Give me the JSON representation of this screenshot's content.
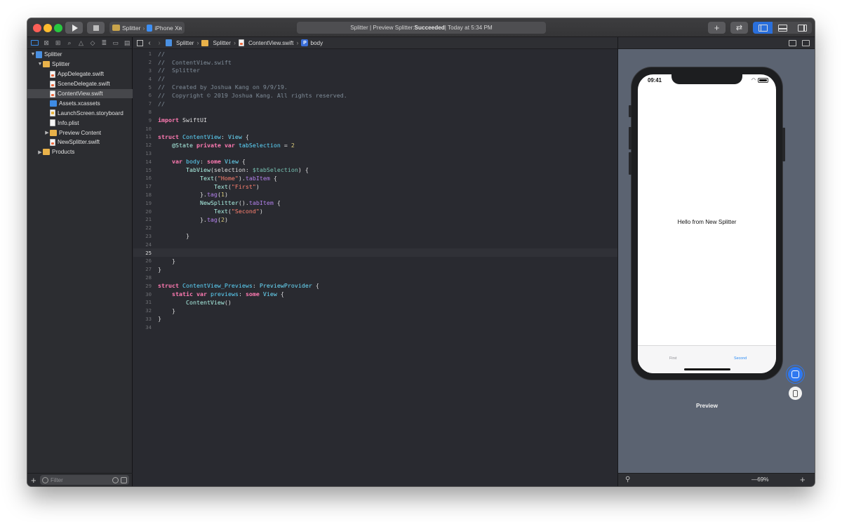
{
  "toolbar": {
    "scheme_name": "Splitter",
    "device_name": "iPhone Xʀ",
    "status_prefix": "Splitter | Preview Splitter: ",
    "status_result": "Succeeded",
    "status_suffix": " | Today at 5:34 PM",
    "add_label": "+",
    "swap_label": "⇄"
  },
  "navigator": {
    "items": [
      {
        "label": "Splitter",
        "icon": "project-icon",
        "level": 0,
        "disclosure": "open"
      },
      {
        "label": "Splitter",
        "icon": "folder-icon",
        "level": 1,
        "disclosure": "open"
      },
      {
        "label": "AppDelegate.swift",
        "icon": "swift-file-icon",
        "level": 2,
        "disclosure": ""
      },
      {
        "label": "SceneDelegate.swift",
        "icon": "swift-file-icon",
        "level": 2,
        "disclosure": ""
      },
      {
        "label": "ContentView.swift",
        "icon": "swift-file-icon",
        "level": 2,
        "disclosure": "",
        "selected": true
      },
      {
        "label": "Assets.xcassets",
        "icon": "assets-icon",
        "level": 2,
        "disclosure": ""
      },
      {
        "label": "LaunchScreen.storyboard",
        "icon": "storyboard-icon",
        "level": 2,
        "disclosure": ""
      },
      {
        "label": "Info.plist",
        "icon": "plist-icon",
        "level": 2,
        "disclosure": ""
      },
      {
        "label": "Preview Content",
        "icon": "folder-icon",
        "level": 2,
        "disclosure": "closed"
      },
      {
        "label": "NewSplitter.swift",
        "icon": "swift-file-icon",
        "level": 2,
        "disclosure": ""
      },
      {
        "label": "Products",
        "icon": "folder-icon",
        "level": 1,
        "disclosure": "closed"
      }
    ],
    "filter_placeholder": "Filter",
    "add_label": "+"
  },
  "jumpbar": {
    "crumbs": [
      "Splitter",
      "Splitter",
      "ContentView.swift",
      "body"
    ],
    "symbol_badge": "P"
  },
  "editor": {
    "current_line": 25,
    "lines": [
      [
        [
          "comment",
          "//"
        ]
      ],
      [
        [
          "comment",
          "//  ContentView.swift"
        ]
      ],
      [
        [
          "comment",
          "//  Splitter"
        ]
      ],
      [
        [
          "comment",
          "//"
        ]
      ],
      [
        [
          "comment",
          "//  Created by Joshua Kang on 9/9/19."
        ]
      ],
      [
        [
          "comment",
          "//  Copyright © 2019 Joshua Kang. All rights reserved."
        ]
      ],
      [
        [
          "comment",
          "//"
        ]
      ],
      [],
      [
        [
          "keyword",
          "import"
        ],
        [
          "plain",
          " SwiftUI"
        ]
      ],
      [],
      [
        [
          "keyword",
          "struct"
        ],
        [
          "plain",
          " "
        ],
        [
          "decl",
          "ContentView"
        ],
        [
          "plain",
          ": "
        ],
        [
          "typeref",
          "View"
        ],
        [
          "plain",
          " {"
        ]
      ],
      [
        [
          "plain",
          "    "
        ],
        [
          "type",
          "@State"
        ],
        [
          "plain",
          " "
        ],
        [
          "keyword",
          "private"
        ],
        [
          "plain",
          " "
        ],
        [
          "keyword",
          "var"
        ],
        [
          "plain",
          " "
        ],
        [
          "decl",
          "tabSelection"
        ],
        [
          "plain",
          " = "
        ],
        [
          "number",
          "2"
        ]
      ],
      [],
      [
        [
          "plain",
          "    "
        ],
        [
          "keyword",
          "var"
        ],
        [
          "plain",
          " "
        ],
        [
          "decl",
          "body"
        ],
        [
          "plain",
          ": "
        ],
        [
          "keyword",
          "some"
        ],
        [
          "plain",
          " "
        ],
        [
          "typeref",
          "View"
        ],
        [
          "plain",
          " {"
        ]
      ],
      [
        [
          "plain",
          "        "
        ],
        [
          "type",
          "TabView"
        ],
        [
          "plain",
          "(selection: "
        ],
        [
          "var",
          "$tabSelection"
        ],
        [
          "plain",
          ") {"
        ]
      ],
      [
        [
          "plain",
          "            "
        ],
        [
          "type",
          "Text"
        ],
        [
          "plain",
          "("
        ],
        [
          "string",
          "\"Home\""
        ],
        [
          "plain",
          ")."
        ],
        [
          "call",
          "tabItem"
        ],
        [
          "plain",
          " {"
        ]
      ],
      [
        [
          "plain",
          "                "
        ],
        [
          "type",
          "Text"
        ],
        [
          "plain",
          "("
        ],
        [
          "string",
          "\"First\""
        ],
        [
          "plain",
          ")"
        ]
      ],
      [
        [
          "plain",
          "            }."
        ],
        [
          "call",
          "tag"
        ],
        [
          "plain",
          "("
        ],
        [
          "number",
          "1"
        ],
        [
          "plain",
          ")"
        ]
      ],
      [
        [
          "plain",
          "            "
        ],
        [
          "type",
          "NewSplitter"
        ],
        [
          "plain",
          "()."
        ],
        [
          "call",
          "tabItem"
        ],
        [
          "plain",
          " {"
        ]
      ],
      [
        [
          "plain",
          "                "
        ],
        [
          "type",
          "Text"
        ],
        [
          "plain",
          "("
        ],
        [
          "string",
          "\"Second\""
        ],
        [
          "plain",
          ")"
        ]
      ],
      [
        [
          "plain",
          "            }."
        ],
        [
          "call",
          "tag"
        ],
        [
          "plain",
          "("
        ],
        [
          "number",
          "2"
        ],
        [
          "plain",
          ")"
        ]
      ],
      [],
      [
        [
          "plain",
          "        }"
        ]
      ],
      [],
      [],
      [
        [
          "plain",
          "    }"
        ]
      ],
      [
        [
          "plain",
          "}"
        ]
      ],
      [],
      [
        [
          "keyword",
          "struct"
        ],
        [
          "plain",
          " "
        ],
        [
          "decl",
          "ContentView_Previews"
        ],
        [
          "plain",
          ": "
        ],
        [
          "typeref",
          "PreviewProvider"
        ],
        [
          "plain",
          " {"
        ]
      ],
      [
        [
          "plain",
          "    "
        ],
        [
          "keyword",
          "static"
        ],
        [
          "plain",
          " "
        ],
        [
          "keyword",
          "var"
        ],
        [
          "plain",
          " "
        ],
        [
          "decl",
          "previews"
        ],
        [
          "plain",
          ": "
        ],
        [
          "keyword",
          "some"
        ],
        [
          "plain",
          " "
        ],
        [
          "typeref",
          "View"
        ],
        [
          "plain",
          " {"
        ]
      ],
      [
        [
          "plain",
          "        "
        ],
        [
          "type",
          "ContentView"
        ],
        [
          "plain",
          "()"
        ]
      ],
      [
        [
          "plain",
          "    }"
        ]
      ],
      [
        [
          "plain",
          "}"
        ]
      ],
      []
    ]
  },
  "preview": {
    "status_time": "09:41",
    "hello_text": "Hello from New Splitter",
    "tabs": [
      "First",
      "Second"
    ],
    "selected_tab": "Second",
    "label": "Preview",
    "zoom": "69%",
    "zoom_out_label": "—",
    "zoom_in_label": "+"
  },
  "colors": {
    "accent": "#2f78f0",
    "editor_background": "#292a30",
    "canvas_background": "#5b6371",
    "comment": "#7f8c98",
    "keyword": "#ff7ab2",
    "string": "#ff8170",
    "number": "#d9c97c"
  }
}
